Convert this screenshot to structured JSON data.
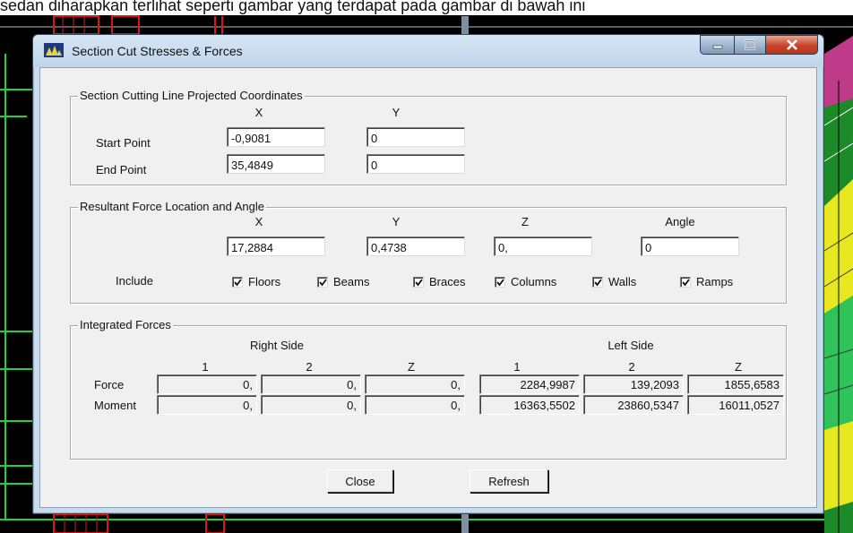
{
  "background": {
    "caption_text": "sedan diharapkan terlihat seperti gambar yang terdapat pada gambar di bawah ini"
  },
  "window": {
    "title": "Section Cut Stresses & Forces",
    "controls": {
      "minimize": "minimize",
      "maximize": "maximize",
      "close": "close"
    }
  },
  "coords": {
    "group_label": "Section Cutting Line Projected Coordinates",
    "col_x": "X",
    "col_y": "Y",
    "start_label": "Start Point",
    "start_x": "-0,9081",
    "start_y": "0",
    "end_label": "End Point",
    "end_x": "35,4849",
    "end_y": "0"
  },
  "resultant": {
    "group_label": "Resultant Force Location and Angle",
    "col_x": "X",
    "col_y": "Y",
    "col_z": "Z",
    "col_angle": "Angle",
    "x": "17,2884",
    "y": "0,4738",
    "z": "0,",
    "angle": "0",
    "include_label": "Include",
    "include": [
      {
        "label": "Floors",
        "checked": true
      },
      {
        "label": "Beams",
        "checked": true
      },
      {
        "label": "Braces",
        "checked": true
      },
      {
        "label": "Columns",
        "checked": true
      },
      {
        "label": "Walls",
        "checked": true
      },
      {
        "label": "Ramps",
        "checked": true
      }
    ]
  },
  "integrated": {
    "group_label": "Integrated Forces",
    "right_side": "Right Side",
    "left_side": "Left Side",
    "col_headers": [
      "1",
      "2",
      "Z",
      "1",
      "2",
      "Z"
    ],
    "rows": [
      {
        "label": "Force",
        "values": [
          "0,",
          "0,",
          "0,",
          "2284,9987",
          "139,2093",
          "1855,6583"
        ]
      },
      {
        "label": "Moment",
        "values": [
          "0,",
          "0,",
          "0,",
          "16363,5502",
          "23860,5347",
          "16011,0527"
        ]
      }
    ]
  },
  "buttons": {
    "close": "Close",
    "refresh": "Refresh"
  },
  "colors": {
    "title_bar": "#c9dcee",
    "client": "#f0f0f0",
    "close_button": "#c7432a",
    "cad_green": "#1fd23c",
    "cad_red": "#d81818",
    "cad_yellow": "#e8e820"
  }
}
